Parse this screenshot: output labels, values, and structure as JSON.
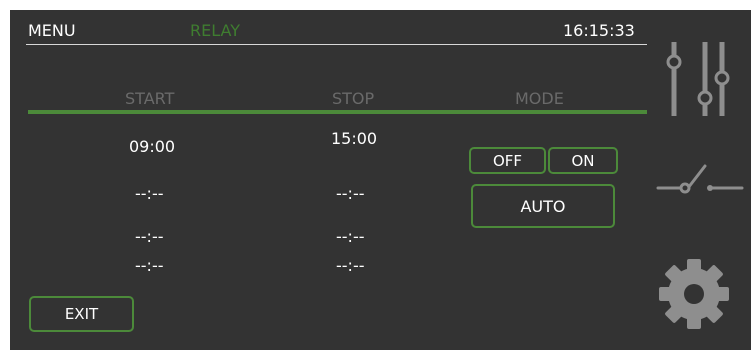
{
  "header": {
    "menu_label": "MENU",
    "relay_label": "RELAY",
    "time": "16:15:33"
  },
  "table": {
    "columns": [
      "START",
      "STOP",
      "MODE"
    ],
    "rows": [
      {
        "start": "09:00",
        "stop": "15:00"
      },
      {
        "start": "--:--",
        "stop": "--:--"
      },
      {
        "start": "--:--",
        "stop": "--:--"
      },
      {
        "start": "--:--",
        "stop": "--:--"
      }
    ]
  },
  "mode": {
    "off_label": "OFF",
    "on_label": "ON",
    "auto_label": "AUTO"
  },
  "exit_label": "EXIT",
  "sidebar": {
    "icons": [
      "sliders-icon",
      "relay-switch-icon",
      "gear-icon"
    ]
  },
  "colors": {
    "background": "#333333",
    "accent": "#4c8a3a",
    "relay_text": "#3f7d30",
    "column_header": "#6a6a6a",
    "icon": "#8e8e8e"
  }
}
